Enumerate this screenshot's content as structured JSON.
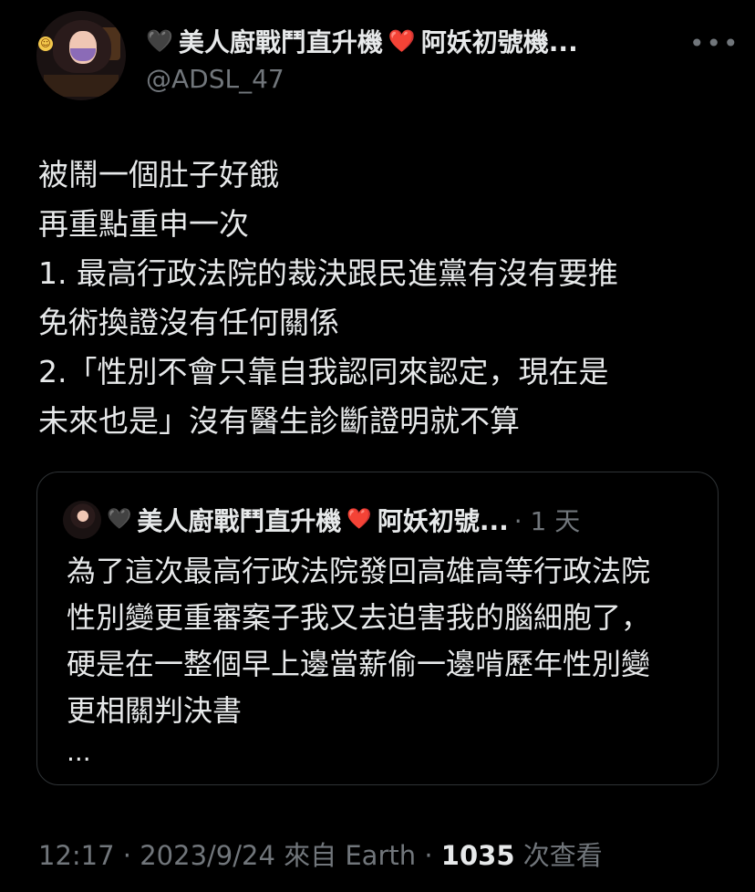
{
  "author": {
    "display_name": "美人廚戰鬥直升機",
    "display_name_suffix": "阿妖初號機...",
    "heart_left": "🖤",
    "heart_mid": "❤️",
    "handle": "@ADSL_47"
  },
  "more_menu": "•••",
  "tweet": {
    "lines": [
      "被鬧一個肚子好餓",
      "再重點重申一次",
      "1. 最高行政法院的裁決跟民進黨有沒有要推",
      "免術換證沒有任何關係",
      "2.「性別不會只靠自我認同來認定，現在是",
      "未來也是」沒有醫生診斷證明就不算"
    ]
  },
  "quote": {
    "heart_left": "🖤",
    "name": "美人廚戰鬥直升機",
    "heart_mid": "❤️",
    "name_suffix": "阿妖初號...",
    "time": "· 1 天",
    "lines": [
      "為了這次最高行政法院發回高雄高等行政法院",
      "性別變更重審案子我又去迫害我的腦細胞了，",
      "硬是在一整個早上邊當薪偷一邊啃歷年性別變",
      "更相關判決書"
    ],
    "ellipsis": "..."
  },
  "meta": {
    "time_date": "12:17 · 2023/9/24 來自 Earth · ",
    "views": "1035",
    "views_suffix": " 次查看"
  }
}
